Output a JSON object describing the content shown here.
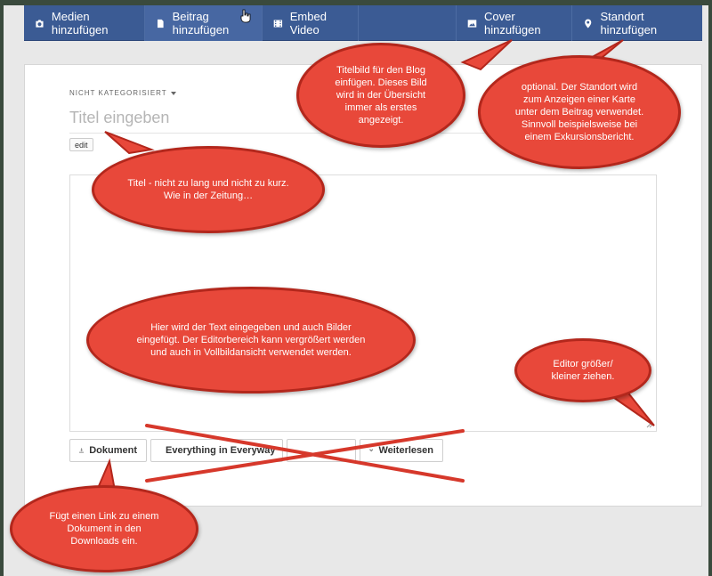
{
  "toolbar": {
    "media_label": "Medien hinzufügen",
    "post_label": "Beitrag hinzufügen",
    "embed_label": "Embed Video",
    "cover_label": "Cover hinzufügen",
    "location_label": "Standort hinzufügen"
  },
  "editor": {
    "category": "NICHT KATEGORISIERT",
    "title_placeholder": "Titel eingeben",
    "edit_label": "edit",
    "buttons": {
      "document": "Dokument",
      "everything": "Everything in Everyway",
      "hidden": "",
      "read_more": "Weiterlesen"
    }
  },
  "annotations": {
    "cover_note": "Titelbild für den Blog einfügen. Dieses Bild wird in der Übersicht immer als erstes angezeigt.",
    "location_note": "optional. Der Standort wird zum Anzeigen einer Karte unter dem Beitrag verwendet. Sinnvoll beispielsweise bei einem Exkursionsbericht.",
    "title_note": "Titel - nicht zu lang und nicht zu kurz. Wie in der Zeitung…",
    "editor_note": "Hier wird der Text eingegeben und auch Bilder eingefügt. Der Editorbereich kann vergrößert werden und auch in Vollbildansicht verwendet werden.",
    "resize_note": "Editor größer/ kleiner ziehen.",
    "document_note": "Fügt einen Link zu einem Dokument in den Downloads ein."
  },
  "colors": {
    "toolbar_bg": "#3b5b94",
    "bubble_fill": "#e8483a",
    "bubble_border": "#b3271c"
  },
  "icons": [
    "camera-icon",
    "document-icon",
    "film-icon",
    "image-icon",
    "map-pin-icon",
    "upload-icon",
    "chevron-down-icon"
  ]
}
